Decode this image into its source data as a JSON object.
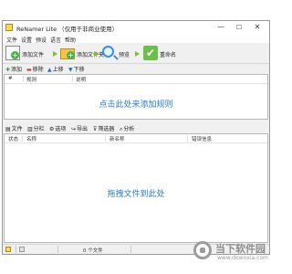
{
  "window": {
    "title": "ReNamer Lite （仅用于非商业使用）",
    "min_glyph": "—",
    "max_glyph": "☐",
    "close_glyph": "✕"
  },
  "menu": [
    "文件",
    "设置",
    "预设",
    "语言",
    "帮助"
  ],
  "toolbar": {
    "add_files": "添加文件",
    "add_folders": "添加文件夹",
    "preview": "预览",
    "rename": "重命名",
    "rename_glyph": "✔"
  },
  "rules_toolbar": {
    "add": "添加",
    "remove": "移除",
    "up": "上移",
    "down": "下移"
  },
  "rules_list": {
    "columns": [
      "#",
      "规则",
      "说明"
    ],
    "hint": "点击此处来添加规则"
  },
  "files_toolbar": {
    "files": "文件",
    "columns": "分栏",
    "options": "选项",
    "export": "导出",
    "filter": "筛选器",
    "analyze": "分析"
  },
  "files_list": {
    "columns": [
      "状态",
      "名称",
      "新名称",
      "错误信息"
    ],
    "hint": "拖拽文件到此处"
  },
  "status": {
    "file_count": "0 个文件"
  },
  "watermark": {
    "brand": "当下软件园",
    "url": "www.downxia.com"
  },
  "colors": {
    "hint": "#2a7ad8",
    "rename_green": "#6cc04a",
    "arrow_green": "#7dbf2f"
  }
}
